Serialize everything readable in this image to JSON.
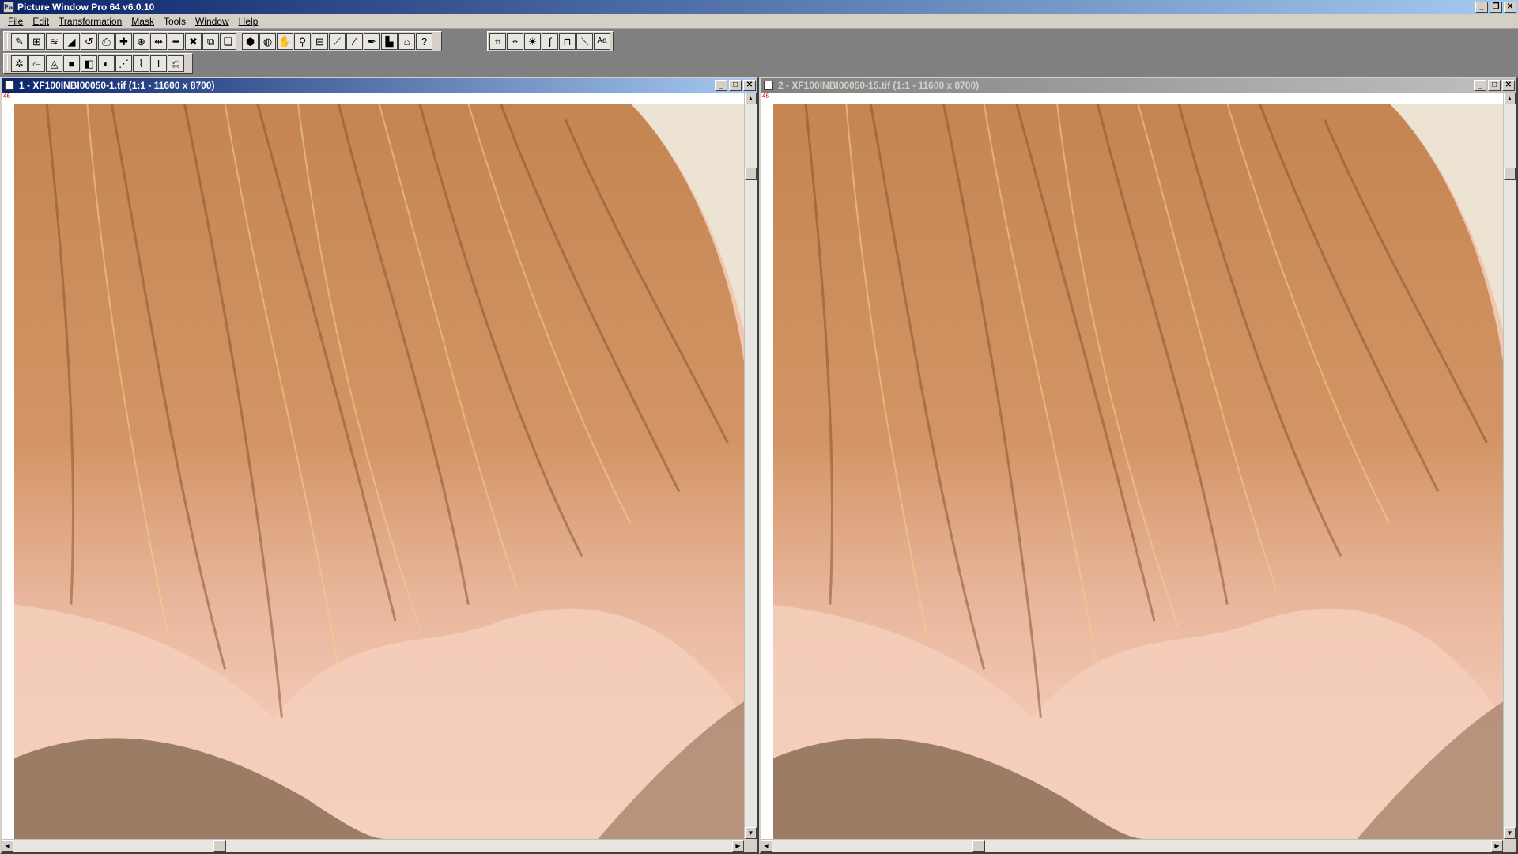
{
  "app": {
    "title": "Picture Window Pro 64  v6.0.10",
    "icon_label": "Pw",
    "controls": {
      "minimize": "_",
      "restore": "❐",
      "close": "✕"
    }
  },
  "menu": {
    "items": [
      "File",
      "Edit",
      "Transformation",
      "Mask",
      "Tools",
      "Window",
      "Help"
    ]
  },
  "toolbar1": {
    "group1": [
      "✎",
      "⊞",
      "≋",
      "◢",
      "↺",
      "⎙",
      "✚",
      "⊕",
      "⇹",
      "━",
      "✖",
      "⧉",
      "❏"
    ],
    "group2": [
      "⬢",
      "◍",
      "✋",
      "⚲",
      "⊟",
      "⟋",
      "⁄",
      "✒",
      "▙",
      "⌂",
      "?"
    ],
    "group3": [
      "⌗",
      "⌖",
      "☀",
      "∫",
      "⊓",
      "⟍",
      "Aa"
    ]
  },
  "toolbar2": {
    "group1": [
      "✲",
      "⟜",
      "◬",
      "■",
      "◧",
      "◐",
      "⋰",
      "⌇",
      "Ι",
      "⎌"
    ]
  },
  "documents": [
    {
      "title": "1 - XF100INBI00050-1.tif (1:1 - 11600 x 8700)",
      "zoom_tag": "46",
      "state": "active"
    },
    {
      "title": "2 - XF100INBI00050-15.tif (1:1 - 11600 x 8700)",
      "zoom_tag": "46",
      "state": "inactive"
    }
  ],
  "scroll": {
    "up": "▲",
    "down": "▼",
    "left": "◀",
    "right": "▶"
  },
  "colors": {
    "title_active_start": "#0a246a",
    "title_active_end": "#a6caf0",
    "face": "#d4d0c8",
    "hair_base": "#c98a55",
    "skin": "#f2c7b0"
  }
}
